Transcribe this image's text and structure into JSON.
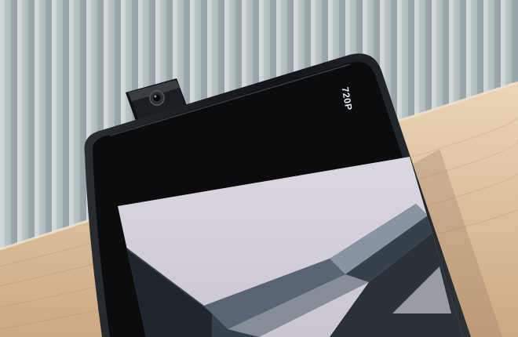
{
  "screen": {
    "resolution_label": "720P"
  },
  "colors": {
    "wall": "#a9b5b8",
    "wood_top": "#e2c9a6",
    "wood_bottom": "#cfae86",
    "phone_body": "#121416",
    "screen_bezel": "#0b0c0d",
    "screen_sky": "#d6d2dc",
    "camera_module": "#1a1c1e"
  },
  "icons": {
    "camera": "popup-camera-icon"
  }
}
